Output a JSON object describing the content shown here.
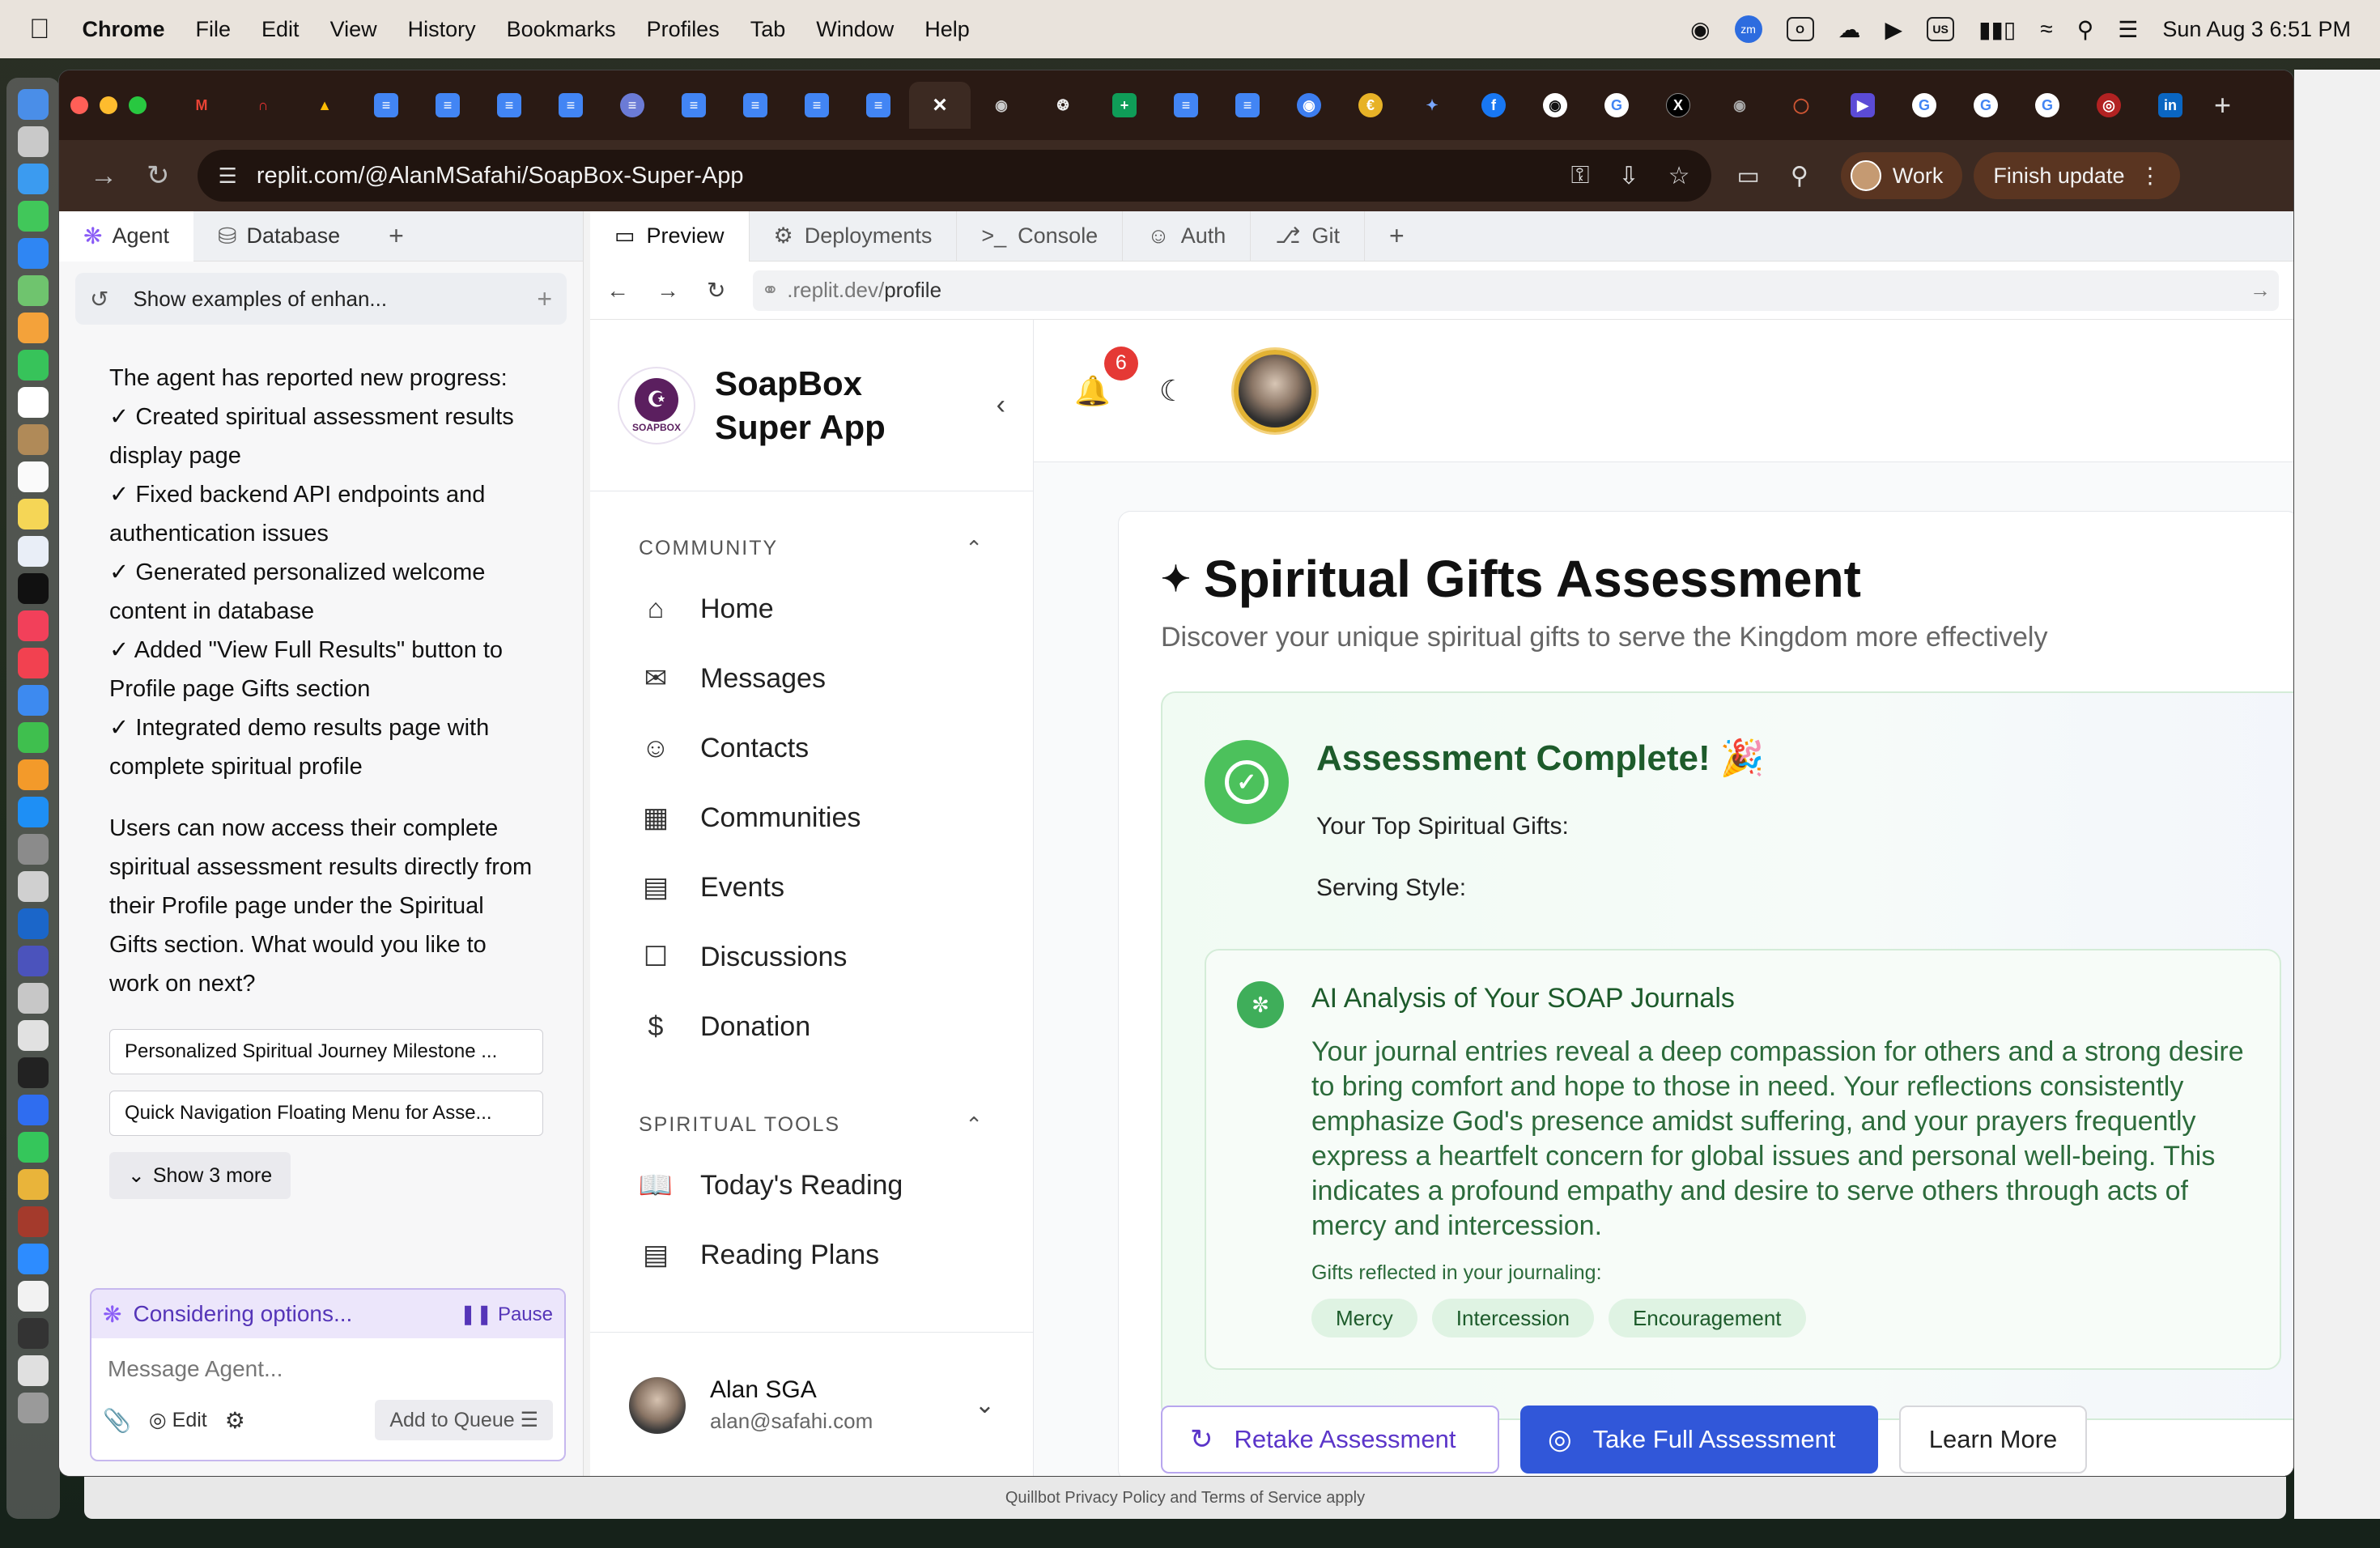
{
  "menubar": {
    "app": "Chrome",
    "items": [
      "File",
      "Edit",
      "View",
      "History",
      "Bookmarks",
      "Profiles",
      "Tab",
      "Window",
      "Help"
    ],
    "input_source": "US",
    "zoom_badge": "zm",
    "datetime": "Sun Aug 3  6:51 PM"
  },
  "browser": {
    "url": "replit.com/@AlanMSafahi/SoapBox-Super-App",
    "profile_label": "Work",
    "update_label": "Finish update",
    "close_tab_glyph": "×",
    "add_tab_glyph": "+"
  },
  "agent_panel": {
    "tabs": {
      "agent": "Agent",
      "database": "Database"
    },
    "history_title": "Show examples of enhan...",
    "paragraphs": [
      "The agent has reported new progress:",
      "✓ Created spiritual assessment results display page",
      "✓ Fixed backend API endpoints and authentication issues",
      "✓ Generated personalized welcome content in database",
      "✓ Added \"View Full Results\" button to Profile page Gifts section",
      "✓ Integrated demo results page with complete spiritual profile"
    ],
    "closing": "Users can now access their complete spiritual assessment results directly from their Profile page under the Spiritual Gifts section. What would you like to work on next?",
    "suggestions": [
      "Personalized Spiritual Journey Milestone ...",
      "Quick Navigation Floating Menu for Asse..."
    ],
    "show_more": "Show 3 more",
    "status": "Considering options...",
    "pause": "Pause",
    "message_placeholder": "Message Agent...",
    "edit": "Edit",
    "queue": "Add to Queue"
  },
  "pane": {
    "tabs": {
      "preview": "Preview",
      "deployments": "Deployments",
      "console": "Console",
      "auth": "Auth",
      "git": "Git"
    },
    "url_prefix": ".replit.dev/",
    "url_path": "profile"
  },
  "app": {
    "brand_line1": "SoapBox",
    "brand_line2": "Super App",
    "logo_text": "SOAPBOX",
    "community_header": "COMMUNITY",
    "community_items": [
      "Home",
      "Messages",
      "Contacts",
      "Communities",
      "Events",
      "Discussions",
      "Donation"
    ],
    "tools_header": "SPIRITUAL TOOLS",
    "tools_items": [
      "Today's Reading",
      "Reading Plans"
    ],
    "user_name": "Alan SGA",
    "user_email": "alan@safahi.com",
    "notification_count": "6",
    "page_title": "Spiritual Gifts Assessment",
    "page_subtitle": "Discover your unique spiritual gifts to serve the Kingdom more effectively",
    "complete_title": "Assessment Complete! 🎉",
    "top_gifts_label": "Your Top Spiritual Gifts:",
    "serving_style_label": "Serving Style:",
    "ai_title": "AI Analysis of Your SOAP Journals",
    "ai_body": "Your journal entries reveal a deep compassion for others and a strong desire to bring comfort and hope to those in need. Your reflections consistently emphasize God's presence amidst suffering, and your prayers frequently express a heartfelt concern for global issues and personal well-being. This indicates a profound empathy and desire to serve others through acts of mercy and intercession.",
    "gifts_label": "Gifts reflected in your journaling:",
    "gift_pills": [
      "Mercy",
      "Intercession",
      "Encouragement"
    ],
    "buttons": {
      "retake": "Retake Assessment",
      "full": "Take Full Assessment",
      "learn": "Learn More"
    }
  },
  "footer_text": "Quillbot Privacy Policy and Terms of Service apply",
  "colors": {
    "accent_purple": "#5b35c9",
    "primary_blue": "#3157d9",
    "success_green": "#4cc15c",
    "badge_red": "#e53935"
  }
}
